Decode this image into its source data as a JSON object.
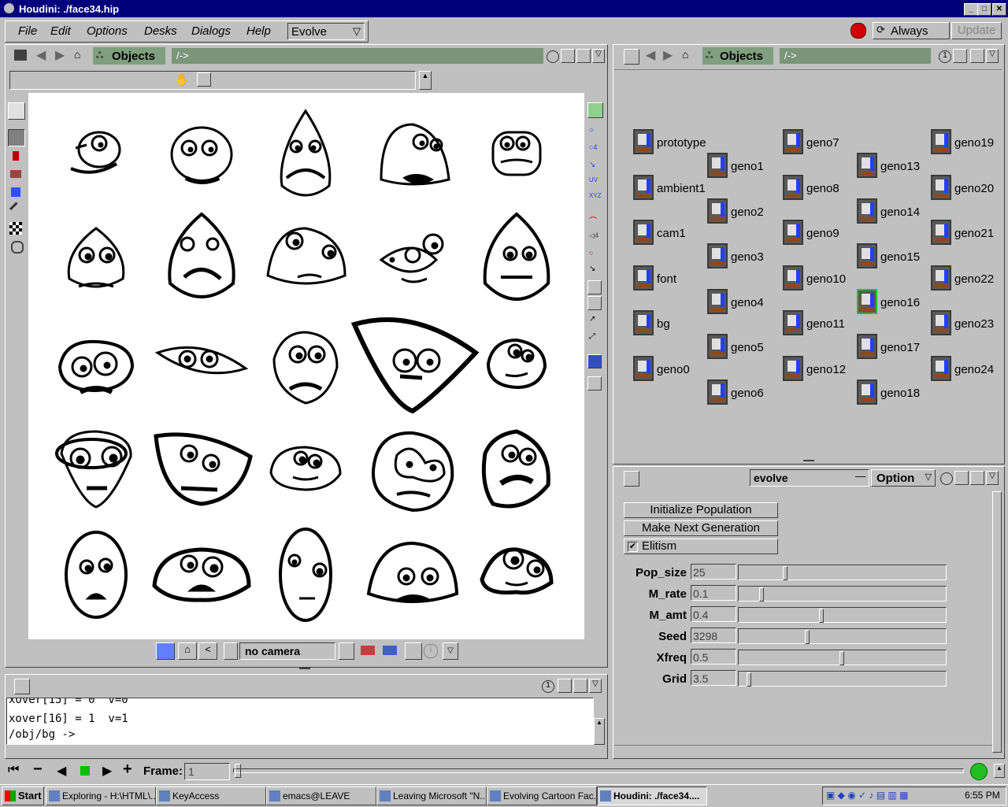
{
  "window": {
    "title": "Houdini: ./face34.hip"
  },
  "menu": {
    "items": [
      "File",
      "Edit",
      "Options",
      "Desks",
      "Dialogs",
      "Help"
    ],
    "desk_select": "Evolve",
    "update_mode": "Always",
    "update_btn": "Update"
  },
  "viewer": {
    "objects_label": "Objects",
    "path": "/->",
    "camera": "no camera"
  },
  "network": {
    "objects_label": "Objects",
    "path": "/->",
    "nodes_col1": [
      "prototype",
      "ambient1",
      "cam1",
      "font",
      "bg",
      "geno0"
    ],
    "nodes_col2": [
      "geno1",
      "geno2",
      "geno3",
      "geno4",
      "geno5",
      "geno6"
    ],
    "nodes_col3": [
      "geno7",
      "geno8",
      "geno9",
      "geno10",
      "geno11",
      "geno12"
    ],
    "nodes_col4": [
      "geno13",
      "geno14",
      "geno15",
      "geno16",
      "geno17",
      "geno18"
    ],
    "nodes_col5": [
      "geno19",
      "geno20",
      "geno21",
      "geno22",
      "geno23",
      "geno24"
    ]
  },
  "params": {
    "op_name": "evolve",
    "option_label": "Option",
    "btn_init": "Initialize Population",
    "btn_next": "Make Next Generation",
    "elitism": "Elitism",
    "rows": [
      {
        "label": "Pop_size",
        "value": "25",
        "level": 0.22
      },
      {
        "label": "M_rate",
        "value": "0.1",
        "level": 0.1
      },
      {
        "label": "M_amt",
        "value": "0.4",
        "level": 0.4
      },
      {
        "label": "Seed",
        "value": "3298",
        "level": 0.33
      },
      {
        "label": "Xfreq",
        "value": "0.5",
        "level": 0.5
      },
      {
        "label": "Grid",
        "value": "3.5",
        "level": 0.04
      }
    ]
  },
  "console": {
    "lines": [
      "xover[15] = 0  v=0",
      "xover[16] = 1  v=1",
      "/obj/bg ->"
    ]
  },
  "playbar": {
    "frame_label": "Frame:",
    "frame_value": "1"
  },
  "taskbar": {
    "start": "Start",
    "items": [
      "Exploring - H:\\HTML\\...",
      "KeyAccess",
      "emacs@LEAVE",
      "Leaving Microsoft \"N...",
      "Evolving Cartoon Fac...",
      "Houdini: ./face34...."
    ],
    "clock": "6:55 PM"
  }
}
